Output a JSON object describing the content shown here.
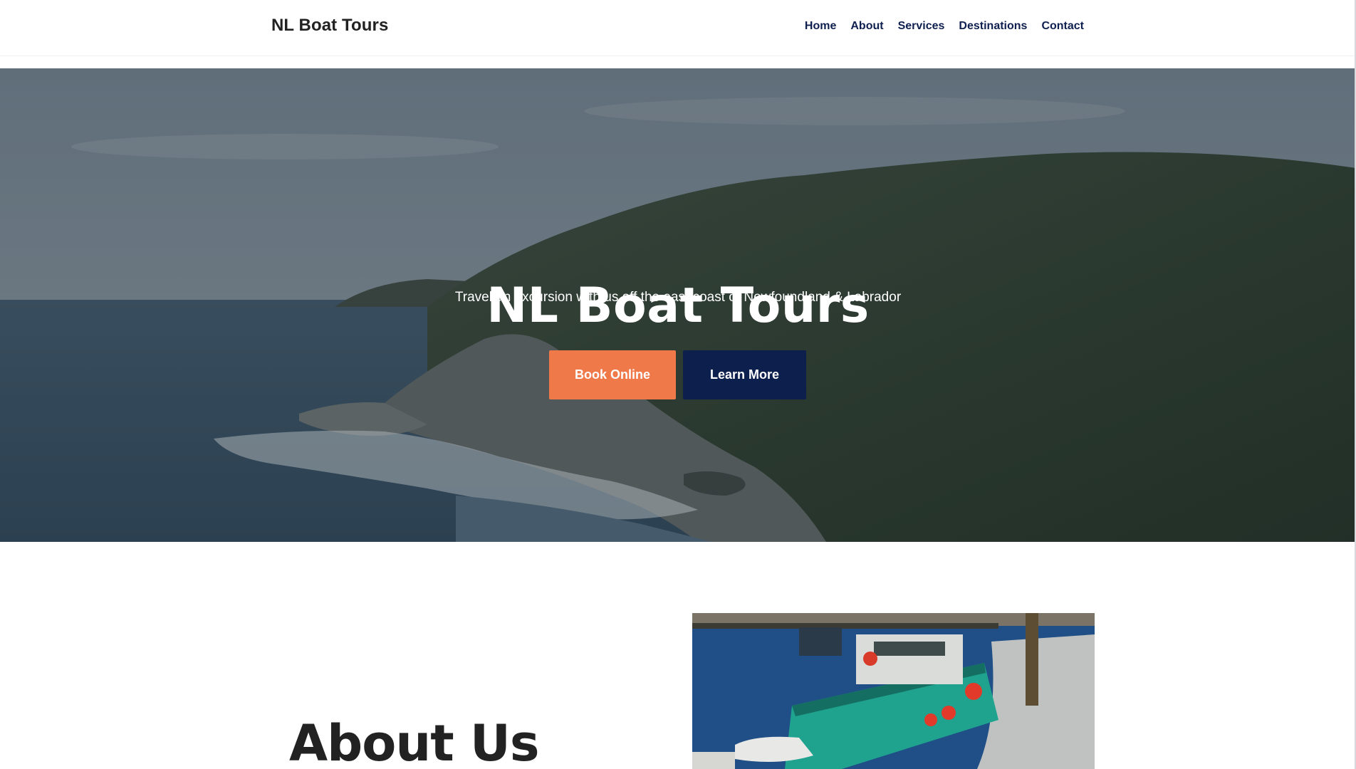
{
  "header": {
    "brand": "NL Boat Tours",
    "nav": [
      "Home",
      "About",
      "Services",
      "Destinations",
      "Contact"
    ]
  },
  "hero": {
    "title": "NL Boat Tours",
    "subtitle": "Travel an excursion with us off the east coast of Newfoundland & Labrador",
    "book_label": "Book Online",
    "learn_label": "Learn More"
  },
  "about": {
    "title": "About Us"
  },
  "colors": {
    "brand_text": "#222222",
    "nav_text": "#0f2050",
    "book_button": "#f0794a",
    "learn_button": "#0c1f4d"
  }
}
